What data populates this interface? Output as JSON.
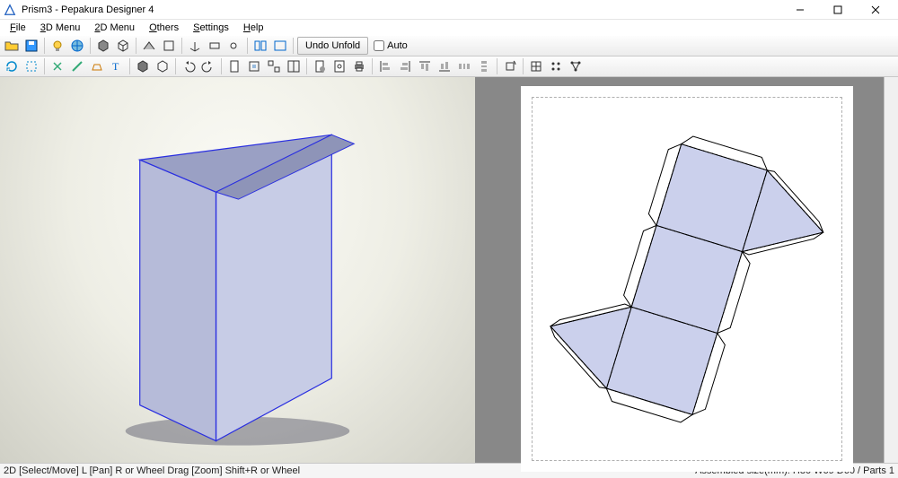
{
  "window": {
    "title": "Prism3 - Pepakura Designer 4"
  },
  "menu": {
    "file": {
      "mnemonic": "F",
      "rest": "ile"
    },
    "menu3d": {
      "mnemonic": "3",
      "rest": "D Menu"
    },
    "menu2d": {
      "mnemonic": "2",
      "rest": "D Menu"
    },
    "others": {
      "mnemonic": "O",
      "rest": "thers"
    },
    "settings": {
      "mnemonic": "S",
      "rest": "ettings"
    },
    "help": {
      "mnemonic": "H",
      "rest": "elp"
    }
  },
  "toolbar1": {
    "undo_unfold": "Undo Unfold",
    "auto": "Auto"
  },
  "statusbar": {
    "left": "2D [Select/Move] L [Pan] R or Wheel Drag [Zoom] Shift+R or Wheel",
    "right": "Assembled size(mm): H80 W69 D60 / Parts 1"
  }
}
